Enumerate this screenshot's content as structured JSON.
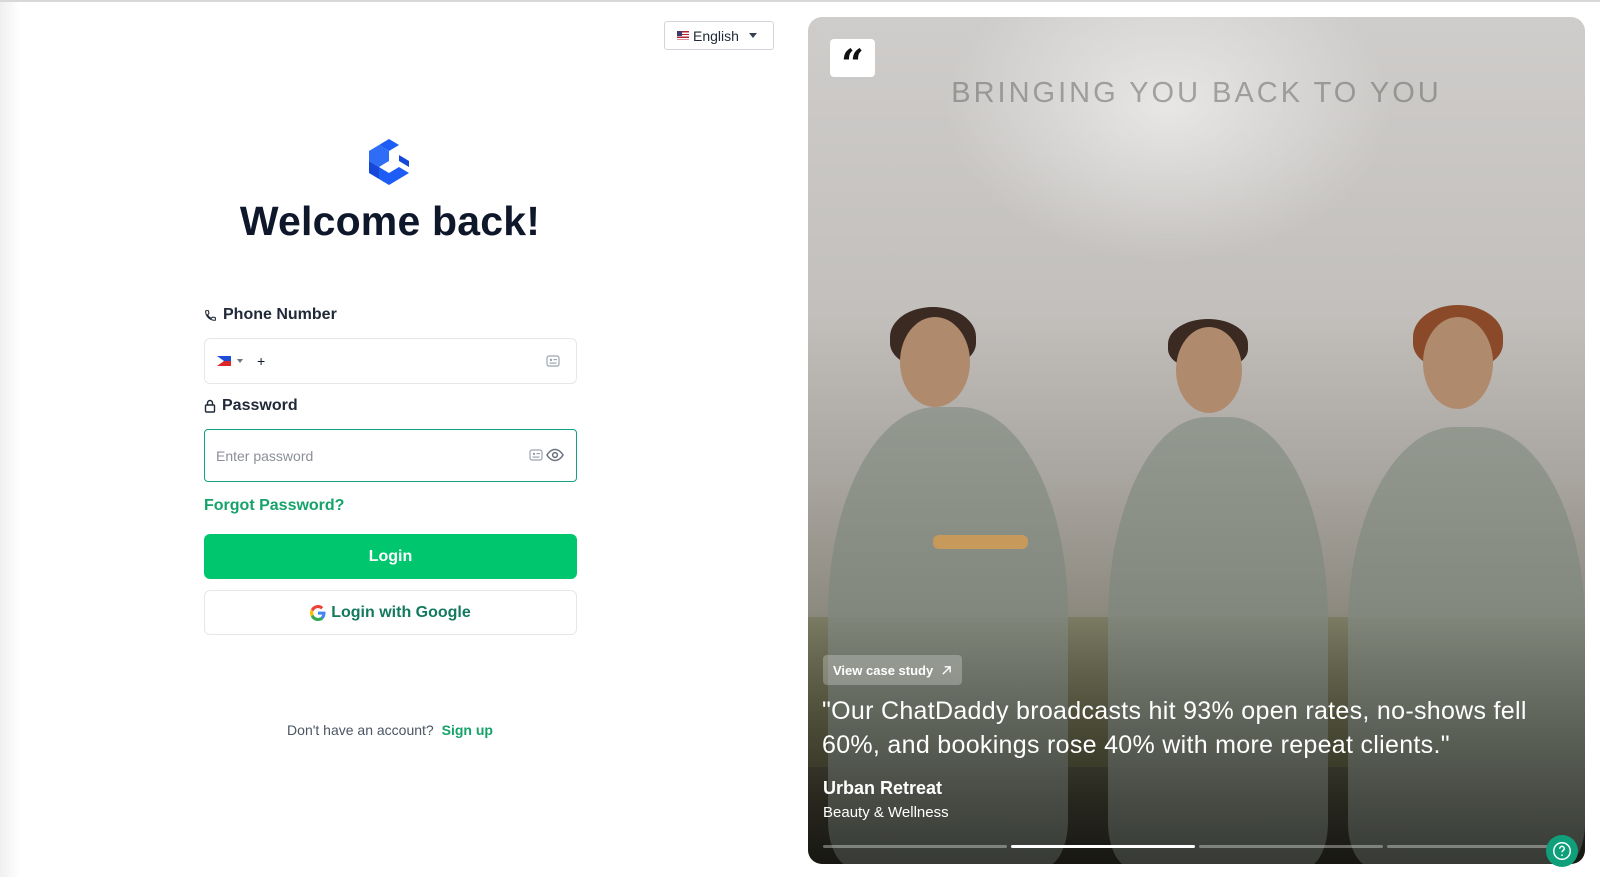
{
  "language": {
    "selected": "English",
    "flag_icon": "us-flag-icon"
  },
  "welcome_title": "Welcome back!",
  "phone": {
    "label": "Phone Number",
    "country_flag_icon": "philippines-flag-icon",
    "prefix": "+",
    "value": ""
  },
  "password": {
    "label": "Password",
    "placeholder": "Enter password",
    "value": ""
  },
  "forgot_password": "Forgot Password?",
  "login_button": "Login",
  "google_button": "Login with Google",
  "signup": {
    "prompt": "Don't have an account?",
    "link": "Sign up"
  },
  "hero": {
    "wall_text": "BRINGING YOU BACK TO YOU",
    "case_study_label": "View case study",
    "quote": "\"Our ChatDaddy broadcasts hit 93% open rates, no-shows fell 60%, and bookings rose 40% with more repeat clients.\"",
    "client_name": "Urban Retreat",
    "client_industry": "Beauty & Wellness",
    "carousel_count": 4,
    "carousel_active_index": 1
  },
  "colors": {
    "primary_green": "#00c76e",
    "link_green": "#16a36a",
    "focus_border": "#14a085",
    "logo_blue": "#1d5cf5",
    "title_dark": "#0f172a"
  }
}
